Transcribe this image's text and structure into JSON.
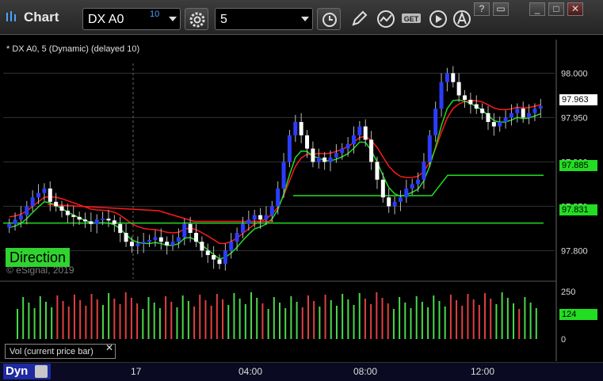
{
  "app": {
    "title": "Chart"
  },
  "toolbar": {
    "symbol": "DX A0",
    "delay_badge": "10",
    "interval": "5"
  },
  "chart": {
    "study_label": "* DX A0, 5 (Dynamic) (delayed 10)",
    "direction_label": "Direction",
    "copyright": "© eSignal, 2019",
    "price_axis": [
      "98.000",
      "97.950",
      "97.900",
      "97.850",
      "97.800"
    ],
    "current_price": "97.963",
    "level_upper": "97.885",
    "level_lower": "97.831",
    "time_axis": [
      "17",
      "04:00",
      "08:00",
      "12:00"
    ]
  },
  "volume": {
    "label": "Vol (current price bar)",
    "axis": [
      "250",
      "0"
    ],
    "current": "124"
  },
  "bottom": {
    "dyn_label": "Dyn"
  },
  "colors": {
    "up_candle": "#2b3cff",
    "down_candle": "#ffffff",
    "red_line": "#ff1a1a",
    "green_line": "#22dd22",
    "vol_up": "#4ad94a",
    "vol_down": "#e04040"
  },
  "chart_data": {
    "type": "candlestick",
    "y_range": [
      97.77,
      98.02
    ],
    "close_series": [
      97.83,
      97.835,
      97.84,
      97.85,
      97.86,
      97.865,
      97.87,
      97.855,
      97.85,
      97.845,
      97.84,
      97.838,
      97.835,
      97.833,
      97.83,
      97.835,
      97.836,
      97.834,
      97.83,
      97.82,
      97.81,
      97.805,
      97.808,
      97.81,
      97.812,
      97.815,
      97.81,
      97.806,
      97.81,
      97.815,
      97.83,
      97.82,
      97.81,
      97.8,
      97.795,
      97.79,
      97.785,
      97.8,
      97.81,
      97.82,
      97.83,
      97.835,
      97.84,
      97.835,
      97.84,
      97.85,
      97.87,
      97.9,
      97.93,
      97.945,
      97.93,
      97.915,
      97.9,
      97.905,
      97.9,
      97.905,
      97.91,
      97.915,
      97.92,
      97.93,
      97.94,
      97.925,
      97.9,
      97.88,
      97.86,
      97.85,
      97.855,
      97.86,
      97.87,
      97.875,
      97.88,
      97.9,
      97.93,
      97.96,
      97.99,
      98.0,
      97.99,
      97.975,
      97.97,
      97.965,
      97.96,
      97.955,
      97.945,
      97.94,
      97.945,
      97.95,
      97.955,
      97.96,
      97.95,
      97.955,
      97.96,
      97.963
    ]
  }
}
